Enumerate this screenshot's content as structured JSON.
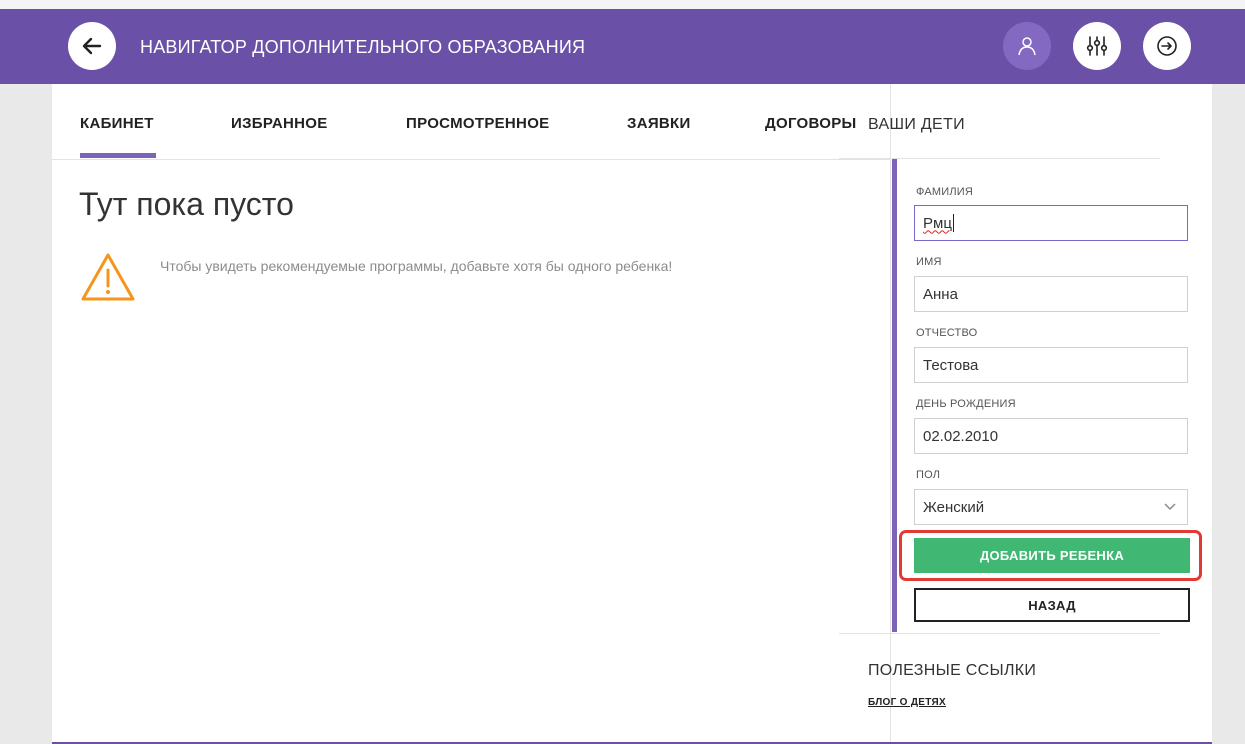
{
  "header": {
    "title": "НАВИГАТОР ДОПОЛНИТЕЛЬНОГО ОБРАЗОВАНИЯ",
    "back_icon": "arrow-left-icon",
    "profile_icon": "user-icon",
    "filter_icon": "sliders-icon",
    "logout_icon": "arrow-right-circle-icon",
    "color": "#6a51a7"
  },
  "tabs": [
    {
      "label": "КАБИНЕТ",
      "active": true
    },
    {
      "label": "ИЗБРАННОЕ"
    },
    {
      "label": "ПРОСМОТРЕННОЕ"
    },
    {
      "label": "ЗАЯВКИ"
    },
    {
      "label": "ДОГОВОРЫ"
    }
  ],
  "main": {
    "empty_title": "Тут пока пусто",
    "empty_message": "Чтобы увидеть рекомендуемые программы, добавьте хотя бы одного ребенка!",
    "warning_icon": "warning-icon",
    "warning_color": "#f7941d"
  },
  "sidebar": {
    "title": "ВАШИ ДЕТИ",
    "form": {
      "surname_label": "ФАМИЛИЯ",
      "surname_value": "Рмц",
      "name_label": "ИМЯ",
      "name_value": "Анна",
      "patronymic_label": "ОТЧЕСТВО",
      "patronymic_value": "Тестова",
      "birthday_label": "ДЕНЬ РОЖДЕНИЯ",
      "birthday_value": "02.02.2010",
      "gender_label": "ПОЛ",
      "gender_value": "Женский",
      "add_button": "ДОБАВИТЬ РЕБЕНКА",
      "back_button": "НАЗАД",
      "add_button_color": "#40b873",
      "highlight_color": "#e03a34"
    },
    "links_title": "ПОЛЕЗНЫЕ ССЫЛКИ",
    "links": [
      {
        "label": "БЛОГ О ДЕТЯХ"
      }
    ]
  }
}
